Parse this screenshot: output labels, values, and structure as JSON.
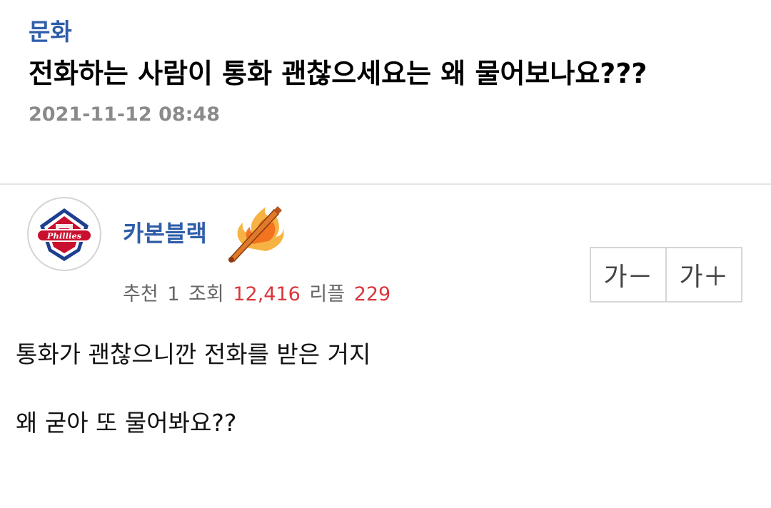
{
  "post": {
    "category": "문화",
    "title": "전화하는 사람이 통화 괜찮으세요는 왜 물어보나요???",
    "date": "2021-11-12 08:48"
  },
  "author": {
    "name": "카본블랙",
    "avatar_icon": "phillies-logo-icon",
    "level_icon": "flaming-bat-icon",
    "avatar_logo_text": "Phillies"
  },
  "stats": {
    "recommend_label": "추천",
    "recommend_value": "1",
    "views_label": "조회",
    "views_value": "12,416",
    "replies_label": "리플",
    "replies_value": "229"
  },
  "font_controls": {
    "decrease_label": "가－",
    "increase_label": "가＋"
  },
  "body": {
    "paragraphs": [
      "통화가 괜찮으니깐 전화를 받은 거지",
      "왜 굳아 또 물어봐요??"
    ]
  },
  "colors": {
    "category": "#2f5ea8",
    "author": "#2f5ea8",
    "stat_value": "#d9373c",
    "meta_label": "#666666",
    "date": "#8a8a8a"
  }
}
